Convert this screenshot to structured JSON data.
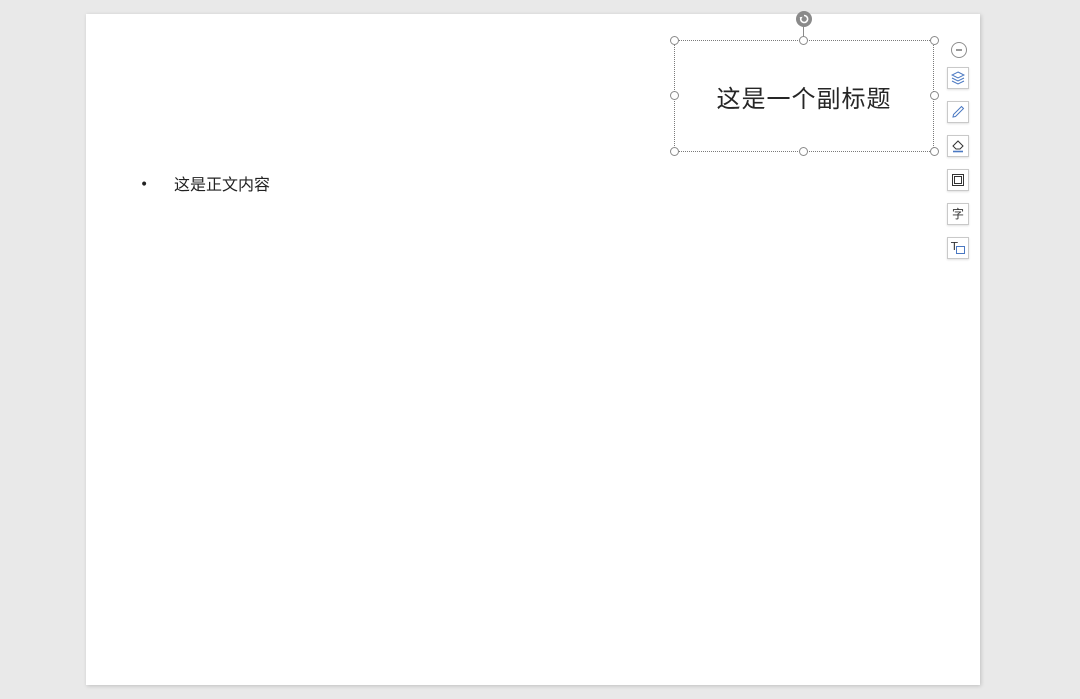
{
  "slide": {
    "body_items": [
      "这是正文内容"
    ],
    "bullet_glyph": "•",
    "subtitle": "这是一个副标题"
  },
  "floating_toolbar": {
    "items": [
      {
        "name": "collapse-toolbar",
        "icon": "minus-circle-icon"
      },
      {
        "name": "layers",
        "icon": "layers-icon"
      },
      {
        "name": "shape-style",
        "icon": "pen-icon"
      },
      {
        "name": "fill-color",
        "icon": "paint-bucket-icon"
      },
      {
        "name": "outline",
        "icon": "shape-outline-icon"
      },
      {
        "name": "text-format",
        "icon": "character-icon",
        "glyph": "字"
      },
      {
        "name": "text-box",
        "icon": "textbox-icon",
        "glyph": "T"
      }
    ]
  },
  "colors": {
    "canvas_bg": "#e9e9e9",
    "slide_bg": "#ffffff",
    "handle_border": "#8a8a8a",
    "toolbar_icon_accent": "#4a78c2"
  }
}
